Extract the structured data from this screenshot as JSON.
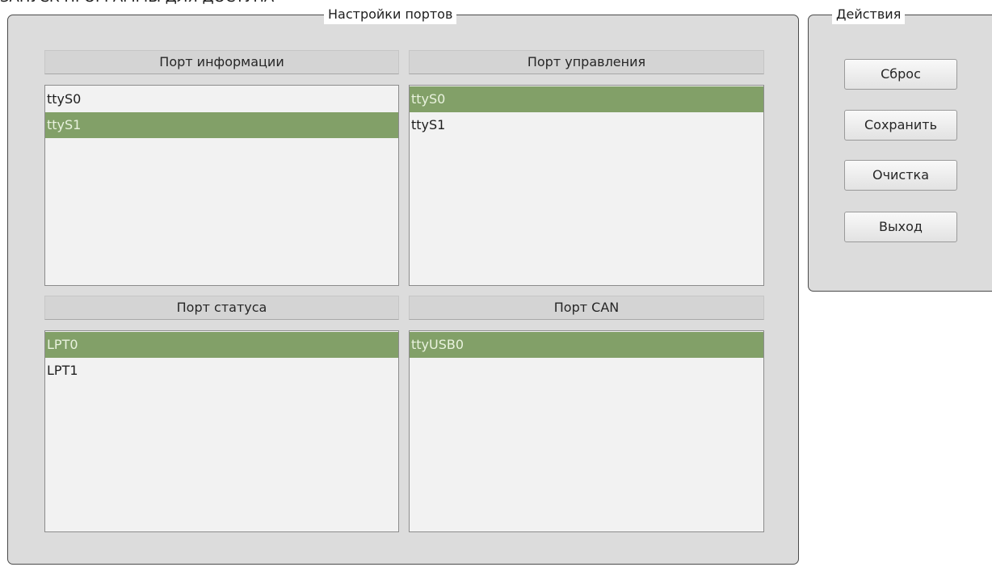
{
  "top_clipped_text": "ЗАПУСК ПРОГРАММЫ ДЛЯ ДОСТУПА",
  "ports_group": {
    "title": "Настройки портов",
    "info_port": {
      "header": "Порт информации",
      "items": [
        "ttyS0",
        "ttyS1"
      ],
      "selected": 1
    },
    "control_port": {
      "header": "Порт управления",
      "items": [
        "ttyS0",
        "ttyS1"
      ],
      "selected": 0
    },
    "status_port": {
      "header": "Порт статуса",
      "items": [
        "LPT0",
        "LPT1"
      ],
      "selected": 0
    },
    "can_port": {
      "header": "Порт CAN",
      "items": [
        "ttyUSB0"
      ],
      "selected": 0
    }
  },
  "actions_group": {
    "title": "Действия",
    "reset_label": "Сброс",
    "save_label": "Сохранить",
    "clear_label": "Очистка",
    "exit_label": "Выход"
  },
  "colors": {
    "selection": "#82a068",
    "selection_text": "#e9f2de",
    "panel": "#dcdcdc",
    "list_bg": "#f2f2f2"
  }
}
